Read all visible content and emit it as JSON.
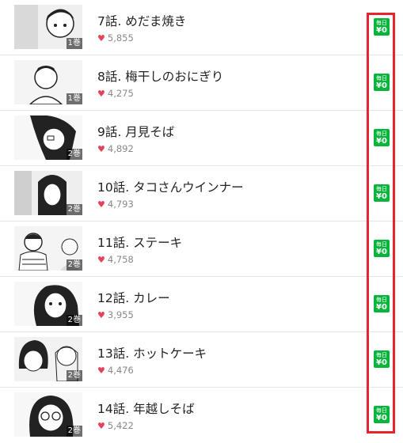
{
  "episodes": [
    {
      "title": "7話. めだま焼き",
      "likes": "5,855",
      "volume": "1巻",
      "badge_top": "毎日",
      "badge_bottom": "¥0"
    },
    {
      "title": "8話. 梅干しのおにぎり",
      "likes": "4,275",
      "volume": "1巻",
      "badge_top": "毎日",
      "badge_bottom": "¥0"
    },
    {
      "title": "9話. 月見そば",
      "likes": "4,892",
      "volume": "2巻",
      "badge_top": "毎日",
      "badge_bottom": "¥0"
    },
    {
      "title": "10話. タコさんウインナー",
      "likes": "4,793",
      "volume": "2巻",
      "badge_top": "毎日",
      "badge_bottom": "¥0"
    },
    {
      "title": "11話. ステーキ",
      "likes": "4,758",
      "volume": "2巻",
      "badge_top": "毎日",
      "badge_bottom": "¥0"
    },
    {
      "title": "12話. カレー",
      "likes": "3,955",
      "volume": "2巻",
      "badge_top": "毎日",
      "badge_bottom": "¥0"
    },
    {
      "title": "13話. ホットケーキ",
      "likes": "4,476",
      "volume": "2巻",
      "badge_top": "毎日",
      "badge_bottom": "¥0"
    },
    {
      "title": "14話. 年越しそば",
      "likes": "5,422",
      "volume": "2巻",
      "badge_top": "毎日",
      "badge_bottom": "¥0"
    }
  ],
  "colors": {
    "badge": "#07b53b",
    "heart": "#e3435a",
    "highlight": "#e8232b"
  },
  "icons": {
    "like": "heart-icon"
  }
}
